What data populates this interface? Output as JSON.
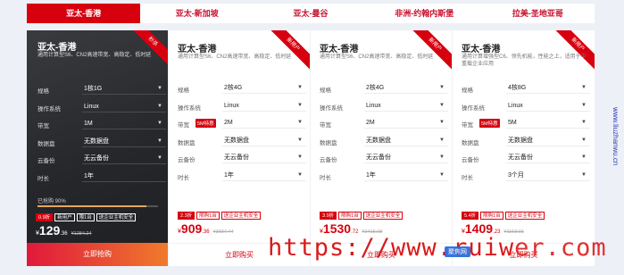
{
  "tabs": [
    {
      "label": "亚太-香港",
      "active": true
    },
    {
      "label": "亚太-新加坡",
      "active": false
    },
    {
      "label": "亚太-曼谷",
      "active": false
    },
    {
      "label": "非洲-约翰内斯堡",
      "active": false
    },
    {
      "label": "拉美-圣地亚哥",
      "active": false
    }
  ],
  "cards": [
    {
      "title": "亚太-香港",
      "desc": "通用计算型S6、CN2高速带宽、高稳定、低时延",
      "ribbon": "秒杀",
      "rows": [
        {
          "label": "规格",
          "value": "1核1G"
        },
        {
          "label": "操作系统",
          "value": "Linux"
        },
        {
          "label": "带宽",
          "value": "1M"
        },
        {
          "label": "数据盘",
          "value": "无数据盘"
        },
        {
          "label": "云备份",
          "value": "无云备份"
        },
        {
          "label": "时长",
          "value": "1年"
        }
      ],
      "sold_text": "已抢购 90%",
      "sold_pct": 90,
      "badges": [
        "0.9折",
        "新用户",
        "限1台",
        "送企业主机安全"
      ],
      "price_cur": "¥",
      "price_int": "129",
      "price_dec": ".36",
      "price_orig": "¥1284.24",
      "buy_label": "立即抢购"
    },
    {
      "title": "亚太-香港",
      "desc": "通用计算型S6、CN2高速带宽、高稳定、低时延",
      "ribbon": "新用户",
      "rows": [
        {
          "label": "规格",
          "value": "2核4G"
        },
        {
          "label": "操作系统",
          "value": "Linux"
        },
        {
          "label": "带宽",
          "tag": "5M特惠",
          "value": "2M"
        },
        {
          "label": "数据盘",
          "value": "无数据盘"
        },
        {
          "label": "云备份",
          "value": "无云备份"
        },
        {
          "label": "时长",
          "value": "1年"
        }
      ],
      "badges": [
        "2.3折",
        "限购1台",
        "送企业主机安全"
      ],
      "price_cur": "¥",
      "price_int": "909",
      "price_dec": ".36",
      "price_orig": "¥3937.44",
      "buy_label": "立即购买"
    },
    {
      "title": "亚太-香港",
      "desc": "通用计算型S6、CN2高速带宽、高稳定、低时延",
      "ribbon": "新用户",
      "rows": [
        {
          "label": "规格",
          "value": "2核4G"
        },
        {
          "label": "操作系统",
          "value": "Linux"
        },
        {
          "label": "带宽",
          "value": "2M"
        },
        {
          "label": "数据盘",
          "value": "无数据盘"
        },
        {
          "label": "云备份",
          "value": "无云备份"
        },
        {
          "label": "时长",
          "value": "1年"
        }
      ],
      "badges": [
        "3.9折",
        "限购1台",
        "送企业主机安全"
      ],
      "price_cur": "¥",
      "price_int": "1530",
      "price_dec": ".72",
      "price_orig": "¥2416.08",
      "buy_label": "立即购买"
    },
    {
      "title": "亚太-香港",
      "desc": "通用计算增强型C6、领先机能，性能之上，适用于中重载企业应用",
      "ribbon": "新用户",
      "rows": [
        {
          "label": "规格",
          "value": "4核8G"
        },
        {
          "label": "操作系统",
          "value": "Linux"
        },
        {
          "label": "带宽",
          "tag": "5M特惠",
          "value": "5M"
        },
        {
          "label": "数据盘",
          "value": "无数据盘"
        },
        {
          "label": "云备份",
          "value": "无云备份"
        },
        {
          "label": "时长",
          "value": "3个月"
        }
      ],
      "badges": [
        "5.4折",
        "限购1台",
        "送企业主机安全"
      ],
      "price_cur": "¥",
      "price_int": "1409",
      "price_dec": ".23",
      "price_orig": "¥1163.01",
      "buy_label": "立即购买"
    }
  ],
  "watermark": {
    "prefix": "https://www.ruiw",
    "suffix": "er.com"
  },
  "logo_text": "聚焦网",
  "side_watermark": "www.liuzhanwu.cn"
}
